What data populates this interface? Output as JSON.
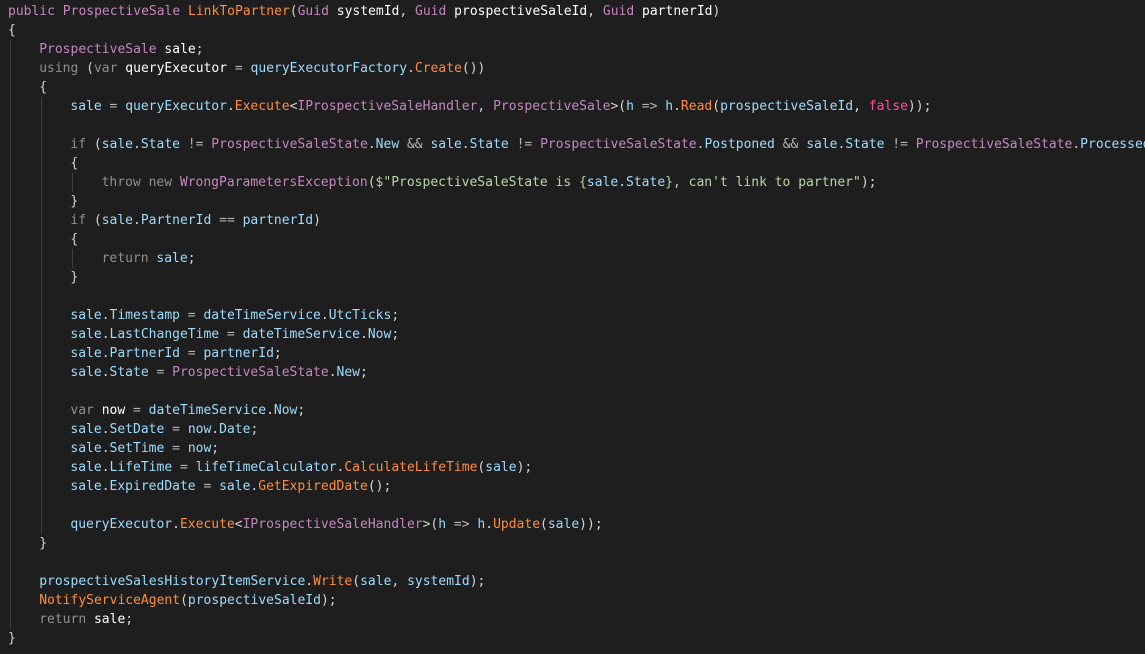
{
  "colors": {
    "background": "#1e1e1e",
    "keyword": "#569cd6",
    "type": "#c586c0",
    "function": "#dcdcaa",
    "method": "#ff8c3c",
    "identifier": "#9cdcfe",
    "local": "#ffffff",
    "punctuation": "#d4d4d4",
    "string": "#d69d85",
    "literal_false": "#ff4f9f"
  },
  "code_lines": [
    {
      "indent": 0,
      "tokens": [
        [
          "public ",
          "kw2"
        ],
        [
          "ProspectiveSale ",
          "type"
        ],
        [
          "LinkToPartner",
          "method"
        ],
        [
          "(",
          "punc"
        ],
        [
          "Guid ",
          "type"
        ],
        [
          "systemId",
          "var"
        ],
        [
          ", ",
          "punc"
        ],
        [
          "Guid ",
          "type"
        ],
        [
          "prospectiveSaleId",
          "var"
        ],
        [
          ", ",
          "punc"
        ],
        [
          "Guid ",
          "type"
        ],
        [
          "partnerId",
          "var"
        ],
        [
          ")",
          "punc"
        ]
      ]
    },
    {
      "indent": 0,
      "tokens": [
        [
          "{",
          "punc"
        ]
      ]
    },
    {
      "indent": 1,
      "tokens": [
        [
          "ProspectiveSale ",
          "type"
        ],
        [
          "sale",
          "var"
        ],
        [
          ";",
          "punc"
        ]
      ]
    },
    {
      "indent": 1,
      "tokens": [
        [
          "using ",
          "ctx"
        ],
        [
          "(",
          "punc"
        ],
        [
          "var ",
          "ctx"
        ],
        [
          "queryExecutor",
          "var"
        ],
        [
          " = ",
          "op"
        ],
        [
          "queryExecutorFactory",
          "field"
        ],
        [
          ".",
          "punc"
        ],
        [
          "Create",
          "method"
        ],
        [
          "())",
          "punc"
        ]
      ]
    },
    {
      "indent": 1,
      "tokens": [
        [
          "{",
          "punc"
        ]
      ]
    },
    {
      "indent": 2,
      "tokens": [
        [
          "sale",
          "field"
        ],
        [
          " = ",
          "op"
        ],
        [
          "queryExecutor",
          "field"
        ],
        [
          ".",
          "punc"
        ],
        [
          "Execute",
          "method"
        ],
        [
          "<",
          "punc"
        ],
        [
          "IProspectiveSaleHandler",
          "type"
        ],
        [
          ", ",
          "punc"
        ],
        [
          "ProspectiveSale",
          "type"
        ],
        [
          ">(",
          "punc"
        ],
        [
          "h",
          "field"
        ],
        [
          " => ",
          "op"
        ],
        [
          "h",
          "field"
        ],
        [
          ".",
          "punc"
        ],
        [
          "Read",
          "method"
        ],
        [
          "(",
          "punc"
        ],
        [
          "prospectiveSaleId",
          "field"
        ],
        [
          ", ",
          "punc"
        ],
        [
          "false",
          "false"
        ],
        [
          "));",
          "punc"
        ]
      ]
    },
    {
      "indent": 2,
      "tokens": []
    },
    {
      "indent": 2,
      "tokens": [
        [
          "if ",
          "ctx"
        ],
        [
          "(",
          "punc"
        ],
        [
          "sale",
          "field"
        ],
        [
          ".",
          "punc"
        ],
        [
          "State",
          "field"
        ],
        [
          " != ",
          "op"
        ],
        [
          "ProspectiveSaleState",
          "type"
        ],
        [
          ".",
          "punc"
        ],
        [
          "New",
          "field"
        ],
        [
          " && ",
          "op"
        ],
        [
          "sale",
          "field"
        ],
        [
          ".",
          "punc"
        ],
        [
          "State",
          "field"
        ],
        [
          " != ",
          "op"
        ],
        [
          "ProspectiveSaleState",
          "type"
        ],
        [
          ".",
          "punc"
        ],
        [
          "Postponed",
          "field"
        ],
        [
          " && ",
          "op"
        ],
        [
          "sale",
          "field"
        ],
        [
          ".",
          "punc"
        ],
        [
          "State",
          "field"
        ],
        [
          " != ",
          "op"
        ],
        [
          "ProspectiveSaleState",
          "type"
        ],
        [
          ".",
          "punc"
        ],
        [
          "Processed",
          "field"
        ],
        [
          ")",
          "punc"
        ]
      ]
    },
    {
      "indent": 2,
      "tokens": [
        [
          "{",
          "punc"
        ]
      ]
    },
    {
      "indent": 3,
      "tokens": [
        [
          "throw ",
          "ctx"
        ],
        [
          "new ",
          "ctx"
        ],
        [
          "WrongParametersException",
          "type"
        ],
        [
          "(",
          "punc"
        ],
        [
          "$\"ProspectiveSaleState is {",
          "iface"
        ],
        [
          "sale",
          "field"
        ],
        [
          ".",
          "punc"
        ],
        [
          "State",
          "field"
        ],
        [
          "}, can't link to partner\"",
          "iface"
        ],
        [
          ");",
          "punc"
        ]
      ]
    },
    {
      "indent": 2,
      "tokens": [
        [
          "}",
          "punc"
        ]
      ]
    },
    {
      "indent": 2,
      "tokens": [
        [
          "if ",
          "ctx"
        ],
        [
          "(",
          "punc"
        ],
        [
          "sale",
          "field"
        ],
        [
          ".",
          "punc"
        ],
        [
          "PartnerId",
          "field"
        ],
        [
          " == ",
          "op"
        ],
        [
          "partnerId",
          "field"
        ],
        [
          ")",
          "punc"
        ]
      ]
    },
    {
      "indent": 2,
      "tokens": [
        [
          "{",
          "punc"
        ]
      ]
    },
    {
      "indent": 3,
      "tokens": [
        [
          "return ",
          "ctx"
        ],
        [
          "sale",
          "field"
        ],
        [
          ";",
          "punc"
        ]
      ]
    },
    {
      "indent": 2,
      "tokens": [
        [
          "}",
          "punc"
        ]
      ]
    },
    {
      "indent": 2,
      "tokens": []
    },
    {
      "indent": 2,
      "tokens": [
        [
          "sale",
          "field"
        ],
        [
          ".",
          "punc"
        ],
        [
          "Timestamp",
          "field"
        ],
        [
          " = ",
          "op"
        ],
        [
          "dateTimeService",
          "field"
        ],
        [
          ".",
          "punc"
        ],
        [
          "UtcTicks",
          "field"
        ],
        [
          ";",
          "punc"
        ]
      ]
    },
    {
      "indent": 2,
      "tokens": [
        [
          "sale",
          "field"
        ],
        [
          ".",
          "punc"
        ],
        [
          "LastChangeTime",
          "field"
        ],
        [
          " = ",
          "op"
        ],
        [
          "dateTimeService",
          "field"
        ],
        [
          ".",
          "punc"
        ],
        [
          "Now",
          "field"
        ],
        [
          ";",
          "punc"
        ]
      ]
    },
    {
      "indent": 2,
      "tokens": [
        [
          "sale",
          "field"
        ],
        [
          ".",
          "punc"
        ],
        [
          "PartnerId",
          "field"
        ],
        [
          " = ",
          "op"
        ],
        [
          "partnerId",
          "field"
        ],
        [
          ";",
          "punc"
        ]
      ]
    },
    {
      "indent": 2,
      "tokens": [
        [
          "sale",
          "field"
        ],
        [
          ".",
          "punc"
        ],
        [
          "State",
          "field"
        ],
        [
          " = ",
          "op"
        ],
        [
          "ProspectiveSaleState",
          "type"
        ],
        [
          ".",
          "punc"
        ],
        [
          "New",
          "field"
        ],
        [
          ";",
          "punc"
        ]
      ]
    },
    {
      "indent": 2,
      "tokens": []
    },
    {
      "indent": 2,
      "tokens": [
        [
          "var ",
          "ctx"
        ],
        [
          "now",
          "var"
        ],
        [
          " = ",
          "op"
        ],
        [
          "dateTimeService",
          "field"
        ],
        [
          ".",
          "punc"
        ],
        [
          "Now",
          "field"
        ],
        [
          ";",
          "punc"
        ]
      ]
    },
    {
      "indent": 2,
      "tokens": [
        [
          "sale",
          "field"
        ],
        [
          ".",
          "punc"
        ],
        [
          "SetDate",
          "field"
        ],
        [
          " = ",
          "op"
        ],
        [
          "now",
          "field"
        ],
        [
          ".",
          "punc"
        ],
        [
          "Date",
          "field"
        ],
        [
          ";",
          "punc"
        ]
      ]
    },
    {
      "indent": 2,
      "tokens": [
        [
          "sale",
          "field"
        ],
        [
          ".",
          "punc"
        ],
        [
          "SetTime",
          "field"
        ],
        [
          " = ",
          "op"
        ],
        [
          "now",
          "field"
        ],
        [
          ";",
          "punc"
        ]
      ]
    },
    {
      "indent": 2,
      "tokens": [
        [
          "sale",
          "field"
        ],
        [
          ".",
          "punc"
        ],
        [
          "LifeTime",
          "field"
        ],
        [
          " = ",
          "op"
        ],
        [
          "lifeTimeCalculator",
          "field"
        ],
        [
          ".",
          "punc"
        ],
        [
          "CalculateLifeTime",
          "method"
        ],
        [
          "(",
          "punc"
        ],
        [
          "sale",
          "field"
        ],
        [
          ");",
          "punc"
        ]
      ]
    },
    {
      "indent": 2,
      "tokens": [
        [
          "sale",
          "field"
        ],
        [
          ".",
          "punc"
        ],
        [
          "ExpiredDate",
          "field"
        ],
        [
          " = ",
          "op"
        ],
        [
          "sale",
          "field"
        ],
        [
          ".",
          "punc"
        ],
        [
          "GetExpiredDate",
          "method"
        ],
        [
          "();",
          "punc"
        ]
      ]
    },
    {
      "indent": 2,
      "tokens": []
    },
    {
      "indent": 2,
      "tokens": [
        [
          "queryExecutor",
          "field"
        ],
        [
          ".",
          "punc"
        ],
        [
          "Execute",
          "method"
        ],
        [
          "<",
          "punc"
        ],
        [
          "IProspectiveSaleHandler",
          "type"
        ],
        [
          ">(",
          "punc"
        ],
        [
          "h",
          "field"
        ],
        [
          " => ",
          "op"
        ],
        [
          "h",
          "field"
        ],
        [
          ".",
          "punc"
        ],
        [
          "Update",
          "method"
        ],
        [
          "(",
          "punc"
        ],
        [
          "sale",
          "field"
        ],
        [
          "));",
          "punc"
        ]
      ]
    },
    {
      "indent": 1,
      "tokens": [
        [
          "}",
          "punc"
        ]
      ]
    },
    {
      "indent": 1,
      "tokens": []
    },
    {
      "indent": 1,
      "tokens": [
        [
          "prospectiveSalesHistoryItemService",
          "field"
        ],
        [
          ".",
          "punc"
        ],
        [
          "Write",
          "method"
        ],
        [
          "(",
          "punc"
        ],
        [
          "sale",
          "field"
        ],
        [
          ", ",
          "punc"
        ],
        [
          "systemId",
          "field"
        ],
        [
          ");",
          "punc"
        ]
      ]
    },
    {
      "indent": 1,
      "tokens": [
        [
          "NotifyServiceAgent",
          "method"
        ],
        [
          "(",
          "punc"
        ],
        [
          "prospectiveSaleId",
          "field"
        ],
        [
          ");",
          "punc"
        ]
      ]
    },
    {
      "indent": 1,
      "tokens": [
        [
          "return ",
          "ctx"
        ],
        [
          "sale",
          "var"
        ],
        [
          ";",
          "punc"
        ]
      ]
    },
    {
      "indent": 0,
      "tokens": [
        [
          "}",
          "punc"
        ]
      ]
    }
  ]
}
